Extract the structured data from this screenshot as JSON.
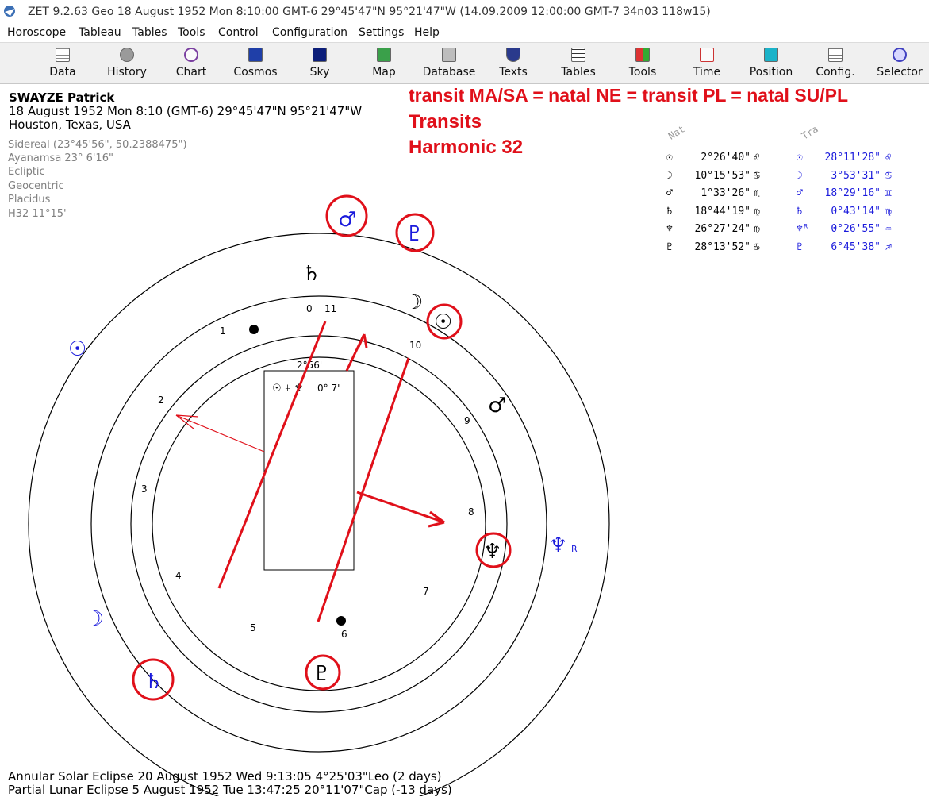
{
  "titlebar": {
    "text": "ZET 9.2.63 Geo    18 August 1952  Mon    8:10:00 GMT-6 29°45'47\"N  95°21'47\"W   (14.09.2009  12:00:00 GMT-7 34n03 118w15)"
  },
  "menu": [
    "Horoscope",
    "Tableau",
    "Tables",
    "Tools",
    "Control",
    "Configuration",
    "Settings",
    "Help"
  ],
  "toolbar": [
    "Data",
    "History",
    "Chart",
    "Cosmos",
    "Sky",
    "Map",
    "Database",
    "Texts",
    "Tables",
    "Tools",
    "Time",
    "Position",
    "Config.",
    "Selector"
  ],
  "person": {
    "name": "SWAYZE Patrick",
    "datetime": "18 August 1952  Mon    8:10 (GMT-6) 29°45'47\"N  95°21'47\"W",
    "place": "Houston, Texas, USA"
  },
  "settings": [
    "Sidereal (23°45'56\", 50.2388475\")",
    "Ayanamsa 23° 6'16\"",
    "Ecliptic",
    "Geocentric",
    "Placidus",
    "H32  11°15'"
  ],
  "annotations": {
    "line1": "transit MA/SA = natal NE = transit PL = natal SU/PL",
    "line2": "Transits",
    "line3": "Harmonic 32"
  },
  "positions": {
    "natal_header": "Nat",
    "transit_header": "Tra",
    "natal_color": "#000000",
    "transit_color": "#1a1adc",
    "natal": [
      {
        "glyph": "☉",
        "value": "2°26'40\"",
        "sign": "♌"
      },
      {
        "glyph": "☽",
        "value": "10°15'53\"",
        "sign": "♋"
      },
      {
        "glyph": "♂",
        "value": "1°33'26\"",
        "sign": "♏"
      },
      {
        "glyph": "♄",
        "value": "18°44'19\"",
        "sign": "♍"
      },
      {
        "glyph": "♆",
        "value": "26°27'24\"",
        "sign": "♍"
      },
      {
        "glyph": "♇",
        "value": "28°13'52\"",
        "sign": "♋"
      }
    ],
    "transit": [
      {
        "glyph": "☉",
        "value": "28°11'28\"",
        "sign": "♌"
      },
      {
        "glyph": "☽",
        "value": "3°53'31\"",
        "sign": "♋"
      },
      {
        "glyph": "♂",
        "value": "18°29'16\"",
        "sign": "♊"
      },
      {
        "glyph": "♄",
        "value": "0°43'14\"",
        "sign": "♍"
      },
      {
        "glyph": "♆ᴿ",
        "value": "0°26'55\"",
        "sign": "♒"
      },
      {
        "glyph": "♇",
        "value": "6°45'38\"",
        "sign": "♐"
      }
    ]
  },
  "chart_center": {
    "top_label": "2°56'",
    "midpoint_text": "0° 7'"
  },
  "house_numbers": [
    "0",
    "11",
    "10",
    "9",
    "8",
    "7",
    "6",
    "5",
    "4",
    "3",
    "2",
    "1"
  ],
  "eclipses": [
    "Annular Solar Eclipse 20 August 1952 Wed  9:13:05  4°25'03\"Leo (2 days)",
    "Partial Lunar Eclipse 5 August 1952 Tue 13:47:25 20°11'07\"Cap (-13 days)"
  ]
}
